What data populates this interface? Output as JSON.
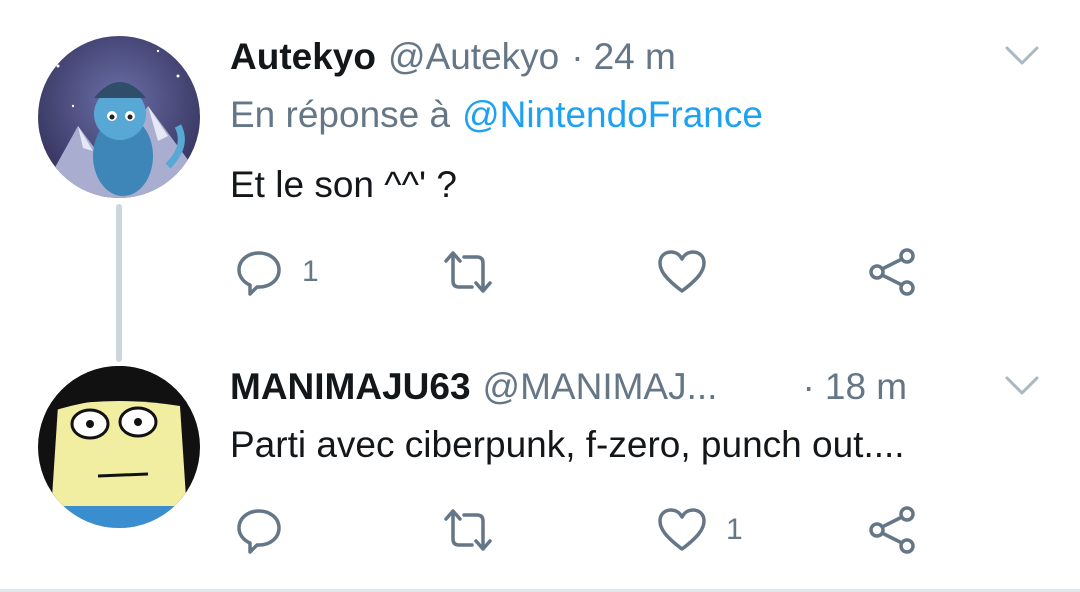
{
  "thread": {
    "tweets": [
      {
        "display_name": "Autekyo",
        "handle": "@Autekyo",
        "separator": "·",
        "time": "24 m",
        "reply_prefix": "En réponse à",
        "reply_mention": "@NintendoFrance",
        "text": "Et le son ^^' ?",
        "reply_count": "1",
        "retweet_count": "",
        "like_count": ""
      },
      {
        "display_name": "MANIMAJU63",
        "handle": "@MANIMAJ...",
        "separator": "·",
        "time": "18 m",
        "text": "Parti avec ciberpunk, f-zero, punch out....",
        "reply_count": "",
        "retweet_count": "",
        "like_count": "1"
      }
    ]
  },
  "colors": {
    "text": "#14171a",
    "secondary": "#657786",
    "link": "#1da1f2",
    "thread_line": "#ccd6dd"
  },
  "icons": [
    "reply-icon",
    "retweet-icon",
    "like-icon",
    "share-icon",
    "chevron-down-icon"
  ]
}
